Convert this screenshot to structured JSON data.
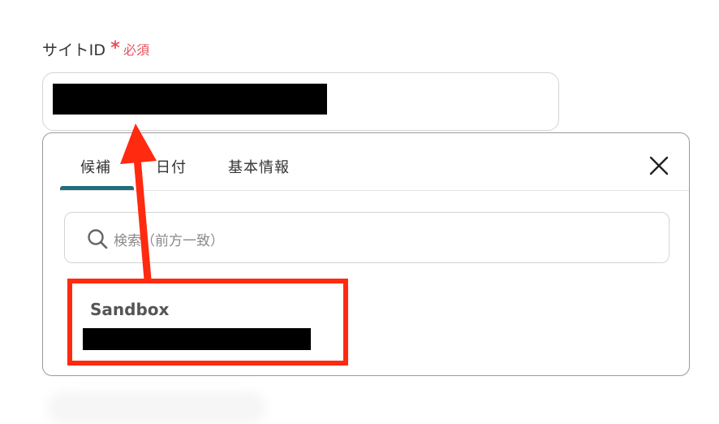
{
  "field": {
    "label": "サイトID",
    "required_mark": "*",
    "required_text": "必須"
  },
  "panel": {
    "tabs": [
      {
        "label": "候補",
        "active": true
      },
      {
        "label": "日付",
        "active": false
      },
      {
        "label": "基本情報",
        "active": false
      }
    ],
    "search_placeholder": "検索（前方一致）",
    "options": [
      {
        "title": "Sandbox"
      }
    ]
  },
  "colors": {
    "required": "#e8505b",
    "active_tab": "#1f6f7f",
    "annotation": "#ff2a0f"
  },
  "icons": {
    "close": "close-icon",
    "search": "search-icon"
  }
}
